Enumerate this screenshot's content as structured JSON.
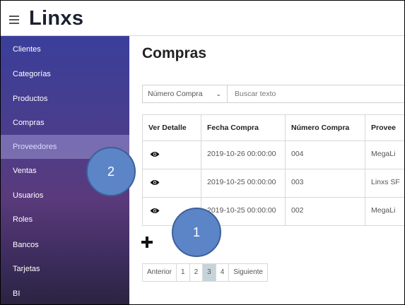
{
  "app": {
    "title": "Linxs"
  },
  "sidebar": {
    "items": [
      {
        "label": "Clientes"
      },
      {
        "label": "Categorías"
      },
      {
        "label": "Productos"
      },
      {
        "label": "Compras"
      },
      {
        "label": "Proveedores",
        "active": true
      },
      {
        "label": "Ventas"
      },
      {
        "label": "Usuarios"
      },
      {
        "label": "Roles"
      },
      {
        "label": "Bancos"
      },
      {
        "label": "Tarjetas"
      },
      {
        "label": "BI"
      }
    ]
  },
  "main": {
    "title": "Compras",
    "filter": {
      "selected": "Número Compra",
      "placeholder": "Buscar texto"
    },
    "table": {
      "headers": [
        "Ver Detalle",
        "Fecha Compra",
        "Número Compra",
        "Provee"
      ],
      "rows": [
        {
          "fecha": "2019-10-26 00:00:00",
          "numero": "004",
          "proveedor": "MegaLi"
        },
        {
          "fecha": "2019-10-25 00:00:00",
          "numero": "003",
          "proveedor": "Linxs SF"
        },
        {
          "fecha": "2019-10-25 00:00:00",
          "numero": "002",
          "proveedor": "MegaLi"
        }
      ]
    },
    "pagination": {
      "prev": "Anterior",
      "pages": [
        "1",
        "2",
        "3",
        "4"
      ],
      "active_page": "3",
      "next": "Siguiente"
    }
  },
  "annotations": {
    "badge1": "1",
    "badge2": "2"
  },
  "colors": {
    "sidebar_top": "#3a3f9a",
    "sidebar_active": "#c8c8ff",
    "badge": "#5b85c7",
    "active_page": "#c7d3db"
  }
}
